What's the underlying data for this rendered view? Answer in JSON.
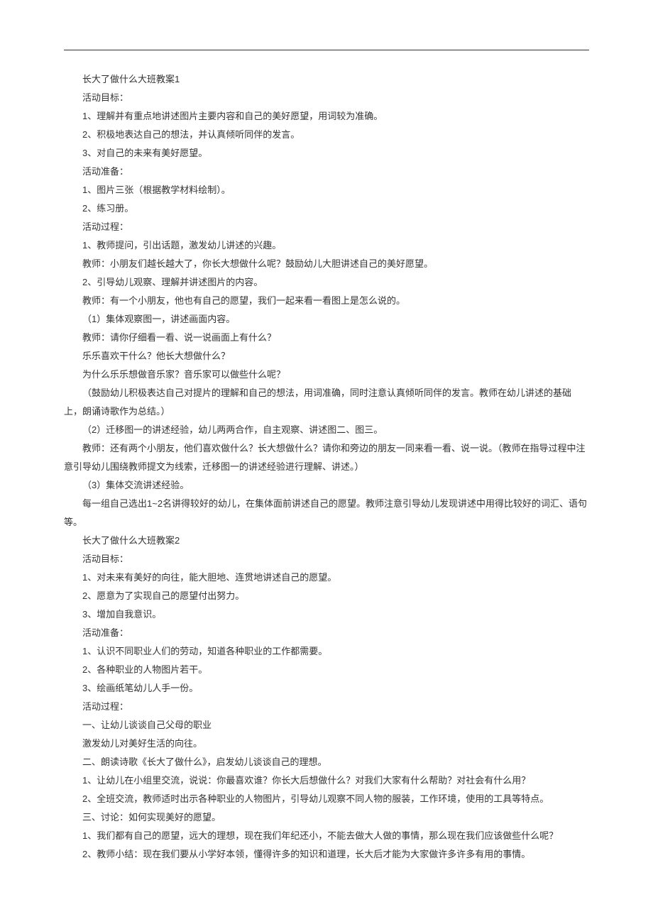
{
  "paragraphs": [
    "长大了做什么大班教案1",
    "活动目标：",
    "1、理解并有重点地讲述图片主要内容和自己的美好愿望，用词较为准确。",
    "2、积极地表达自己的想法，并认真倾听同伴的发言。",
    "3、对自己的未来有美好愿望。",
    "活动准备：",
    "1、图片三张（根据教学材料绘制）。",
    "2、练习册。",
    "活动过程：",
    "1、教师提问，引出话题，激发幼儿讲述的兴趣。",
    "教师：小朋友们越长越大了，你长大想做什么呢？鼓励幼儿大胆讲述自己的美好愿望。",
    "2、引导幼儿观察、理解并讲述图片的内容。",
    "教师：有一个小朋友，他也有自己的愿望，我们一起来看一看图上是怎么说的。",
    "（1）集体观察图一，讲述画面内容。",
    "教师：请你仔细看一看、说一说画面上有什么？",
    "乐乐喜欢干什么？他长大想做什么？",
    "为什么乐乐想做音乐家？音乐家可以做些什么呢？",
    "（鼓励幼儿积极表达自己对提片的理解和自己的想法，用词准确，同时注意认真倾听同伴的发言。教师在幼儿讲述的基础上，朗诵诗歌作为总结。）",
    "（2）迁移图一的讲述经验，幼儿两两合作，自主观察、讲述图二、图三。",
    "教师：还有两个小朋友，他们喜欢做什么？长大想做什么？请你和旁边的朋友一同来看一看、说一说。（教师在指导过程中注意引导幼儿围绕教师提文为线索，迁移图一的讲述经验进行理解、讲述。）",
    "（3）集体交流讲述经验。",
    "每一组自己选出1~2名讲得较好的幼儿，在集体面前讲述自己的愿望。教师注意引导幼儿发现讲述中用得比较好的词汇、语句等。",
    "长大了做什么大班教案2",
    "活动目标：",
    "1、对未来有美好的向往，能大胆地、连贯地讲述自己的愿望。",
    "2、愿意为了实现自己的愿望付出努力。",
    "3、增加自我意识。",
    "活动准备：",
    "1、认识不同职业人们的劳动，知道各种职业的工作都需要。",
    "2、各种职业的人物图片若干。",
    "3、绘画纸笔幼儿人手一份。",
    "活动过程：",
    "一、让幼儿谈谈自己父母的职业",
    "激发幼儿对美好生活的向往。",
    "二、朗读诗歌《长大了做什么》，启发幼儿谈谈自己的理想。",
    "1、让幼儿在小组里交流，说说：你最喜欢谁？你长大后想做什么？对我们大家有什么帮助？对社会有什么用？",
    "2、全班交流，教师适时出示各种职业的人物图片，引导幼儿观察不同人物的服装，工作环境，使用的工具等特点。",
    "三、讨论：如何实现美好的愿望。",
    "1、我们都有自己的愿望，远大的理想，现在我们年纪还小，不能去做大人做的事情，那么现在我们应该做些什么呢？",
    "2、教师小结：现在我们要从小学好本领，懂得许多的知识和道理，长大后才能为大家做许多许多有用的事情。"
  ]
}
